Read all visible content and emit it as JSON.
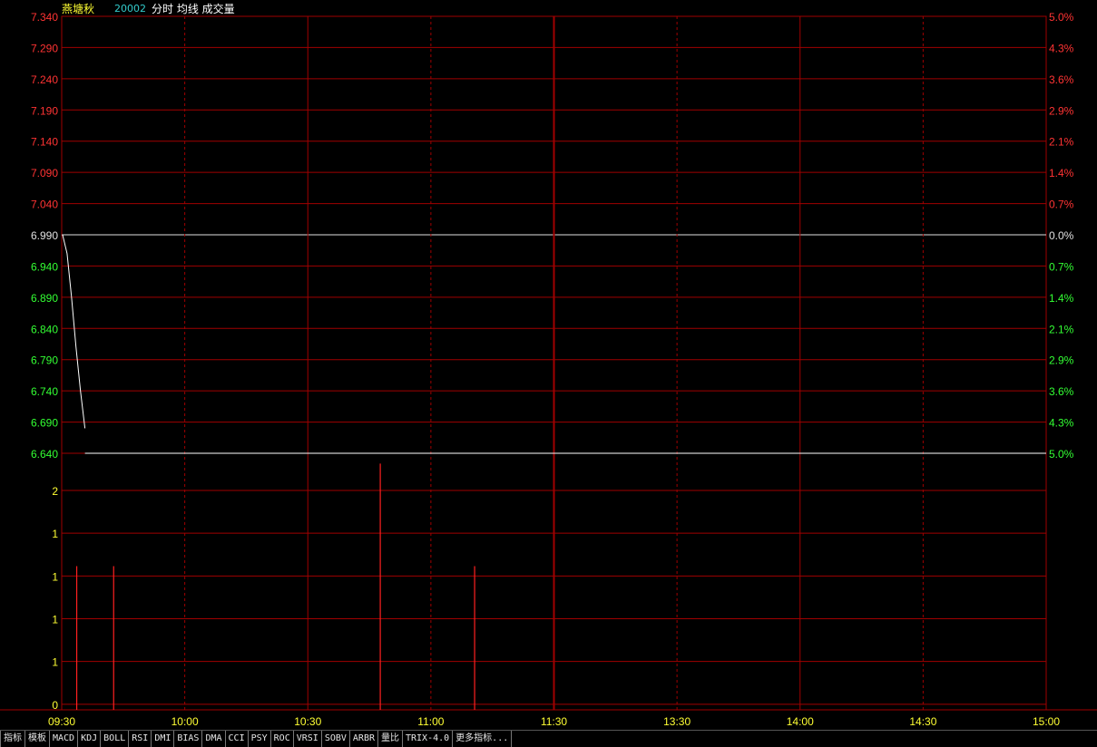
{
  "header": {
    "stock_name": "燕塘秋",
    "stock_code": "20002",
    "indicators_label": "分时 均线 成交量"
  },
  "colors": {
    "grid": "#a00000",
    "price_up": "#ff3333",
    "price_down": "#33ff33",
    "price_flat": "#e0e0e0",
    "volume_label": "#ffff33",
    "time_label": "#ffff33",
    "volume_bar": "#ff2020",
    "price_line": "#ffffff"
  },
  "chart_data": [
    {
      "type": "line",
      "name": "price",
      "x": [
        "09:30",
        "09:31",
        "09:32",
        "09:33",
        "09:34",
        "09:35"
      ],
      "values": [
        6.99,
        6.96,
        6.89,
        6.81,
        6.74,
        6.68
      ],
      "tail": {
        "from": "09:35",
        "to": "15:00",
        "value": 6.64
      },
      "ylim": [
        6.64,
        7.34
      ],
      "reference_close": 6.99,
      "y_ticks_left": [
        "7.340",
        "7.290",
        "7.240",
        "7.190",
        "7.140",
        "7.090",
        "7.040",
        "6.990",
        "6.940",
        "6.890",
        "6.840",
        "6.790",
        "6.740",
        "6.690",
        "6.640"
      ],
      "y_ticks_right": [
        "5.0%",
        "4.3%",
        "3.6%",
        "2.9%",
        "2.1%",
        "1.4%",
        "0.7%",
        "0.0%",
        "0.7%",
        "1.4%",
        "2.1%",
        "2.9%",
        "3.6%",
        "4.3%",
        "5.0%"
      ],
      "x_ticks": [
        "09:30",
        "10:00",
        "10:30",
        "11:00",
        "11:30",
        "13:30",
        "14:00",
        "14:30",
        "15:00"
      ]
    },
    {
      "type": "bar",
      "name": "volume",
      "x_minutes": [
        3,
        12,
        77,
        100
      ],
      "values": [
        1.4,
        1.4,
        2.4,
        1.4
      ],
      "ylim": [
        0,
        2.5
      ],
      "y_ticks": [
        "2",
        "1",
        "1",
        "1",
        "1",
        "0"
      ]
    }
  ],
  "tabs": [
    "指标",
    "模板",
    "MACD",
    "KDJ",
    "BOLL",
    "RSI",
    "DMI",
    "BIAS",
    "DMA",
    "CCI",
    "PSY",
    "ROC",
    "VRSI",
    "SOBV",
    "ARBR",
    "量比",
    "TRIX-4.0",
    "更多指标..."
  ]
}
